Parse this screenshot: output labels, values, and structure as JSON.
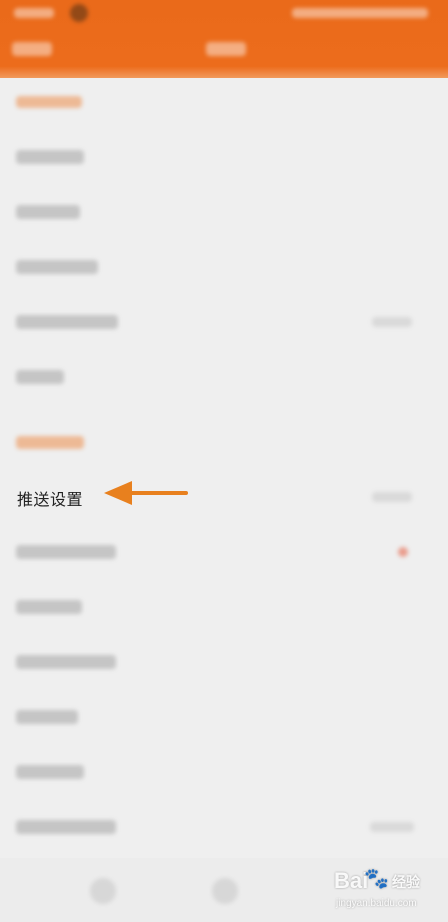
{
  "focus_item": {
    "label": "推送设置"
  },
  "icons": {
    "arrow": "arrow-left-icon",
    "paw": "paw-icon"
  },
  "colors": {
    "header": "#ec6c1c",
    "arrow": "#e8801e",
    "background": "#efefef"
  },
  "watermark": {
    "brand": "Bai",
    "paw": "🐾",
    "brand_cn": "经验",
    "sub": "jingyan.baidu.com"
  }
}
